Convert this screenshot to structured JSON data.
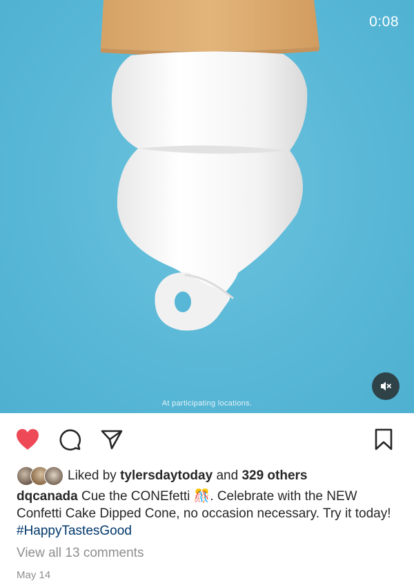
{
  "video": {
    "timer": "0:08",
    "fine_print": "At participating locations.",
    "mute_icon": "speaker-muted-icon"
  },
  "actions": {
    "like_icon": "heart-filled-icon",
    "comment_icon": "comment-bubble-icon",
    "share_icon": "paper-plane-icon",
    "save_icon": "bookmark-icon",
    "like_color": "#ed4956"
  },
  "likes": {
    "prefix": "Liked by",
    "user": "tylersdaytoday",
    "connector": "and",
    "others": "329 others"
  },
  "caption": {
    "username": "dqcanada",
    "text_1": "Cue the CONEfetti",
    "emoji": "🎊",
    "text_2": ". Celebrate with the NEW Confetti Cake Dipped Cone, no occasion necessary. Try it today!",
    "hashtag": "#HappyTastesGood"
  },
  "comments": {
    "view_all": "View all 13 comments"
  },
  "date": "May 14"
}
